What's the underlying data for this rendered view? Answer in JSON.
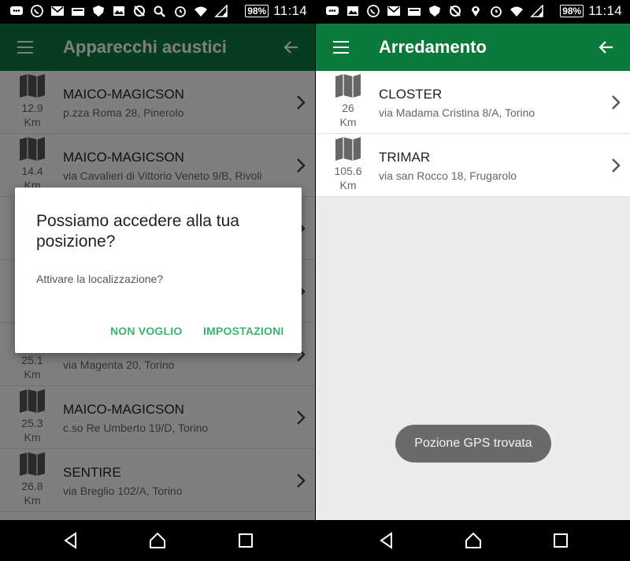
{
  "status": {
    "battery": "98%",
    "time": "11:14"
  },
  "left": {
    "appbar": {
      "title": "Apparecchi acustici"
    },
    "items": [
      {
        "distance": "12.9",
        "unit": "Km",
        "name": "MAICO-MAGICSON",
        "address": "p.zza Roma 28, Pinerolo"
      },
      {
        "distance": "14.4",
        "unit": "Km",
        "name": "MAICO-MAGICSON",
        "address": "via Cavalieri di Vittorio Veneto 9/B, Rivoli"
      },
      {
        "distance": "",
        "unit": "",
        "name": "",
        "address": ""
      },
      {
        "distance": "",
        "unit": "",
        "name": "",
        "address": ""
      },
      {
        "distance": "25.1",
        "unit": "Km",
        "name": "",
        "address": "via Magenta 20, Torino"
      },
      {
        "distance": "25.3",
        "unit": "Km",
        "name": "MAICO-MAGICSON",
        "address": "c.so Re Umberto 19/D, Torino"
      },
      {
        "distance": "26.8",
        "unit": "Km",
        "name": "SENTIRE",
        "address": "via Breglio 102/A, Torino"
      }
    ],
    "dialog": {
      "title": "Possiamo accedere alla tua posizione?",
      "message": "Attivare la localizzazione?",
      "negative": "NON VOGLIO",
      "positive": "IMPOSTAZIONI"
    }
  },
  "right": {
    "appbar": {
      "title": "Arredamento"
    },
    "items": [
      {
        "distance": "26",
        "unit": "Km",
        "name": "CLOSTER",
        "address": "via Madama Cristina 8/A, Torino"
      },
      {
        "distance": "105.6",
        "unit": "Km",
        "name": "TRIMAR",
        "address": "via san Rocco 18, Frugarolo"
      }
    ],
    "toast": "Pozione GPS trovata"
  },
  "colors": {
    "appbar": "#0a7a3c",
    "dialog_button": "#3cb371",
    "toast": "#6a6a6a"
  }
}
